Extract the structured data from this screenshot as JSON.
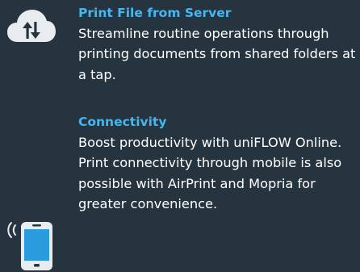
{
  "features": [
    {
      "icon": "cloud-upload-download-icon",
      "title": "Print File from Server",
      "description": "Streamline routine operations through printing documents from shared folders at a tap."
    },
    {
      "icon": "mobile-phone-wireless-icon",
      "title": "Connectivity",
      "description": "Boost productivity with uniFLOW Online. Print connectivity through mobile is also possible with AirPrint and Mopria for greater convenience."
    }
  ],
  "colors": {
    "background": "#26343f",
    "accent": "#45b6f0",
    "text": "#ffffff",
    "icon_fill": "#e8ecef",
    "icon_dark": "#26343f",
    "icon_blue": "#2b9be0"
  }
}
